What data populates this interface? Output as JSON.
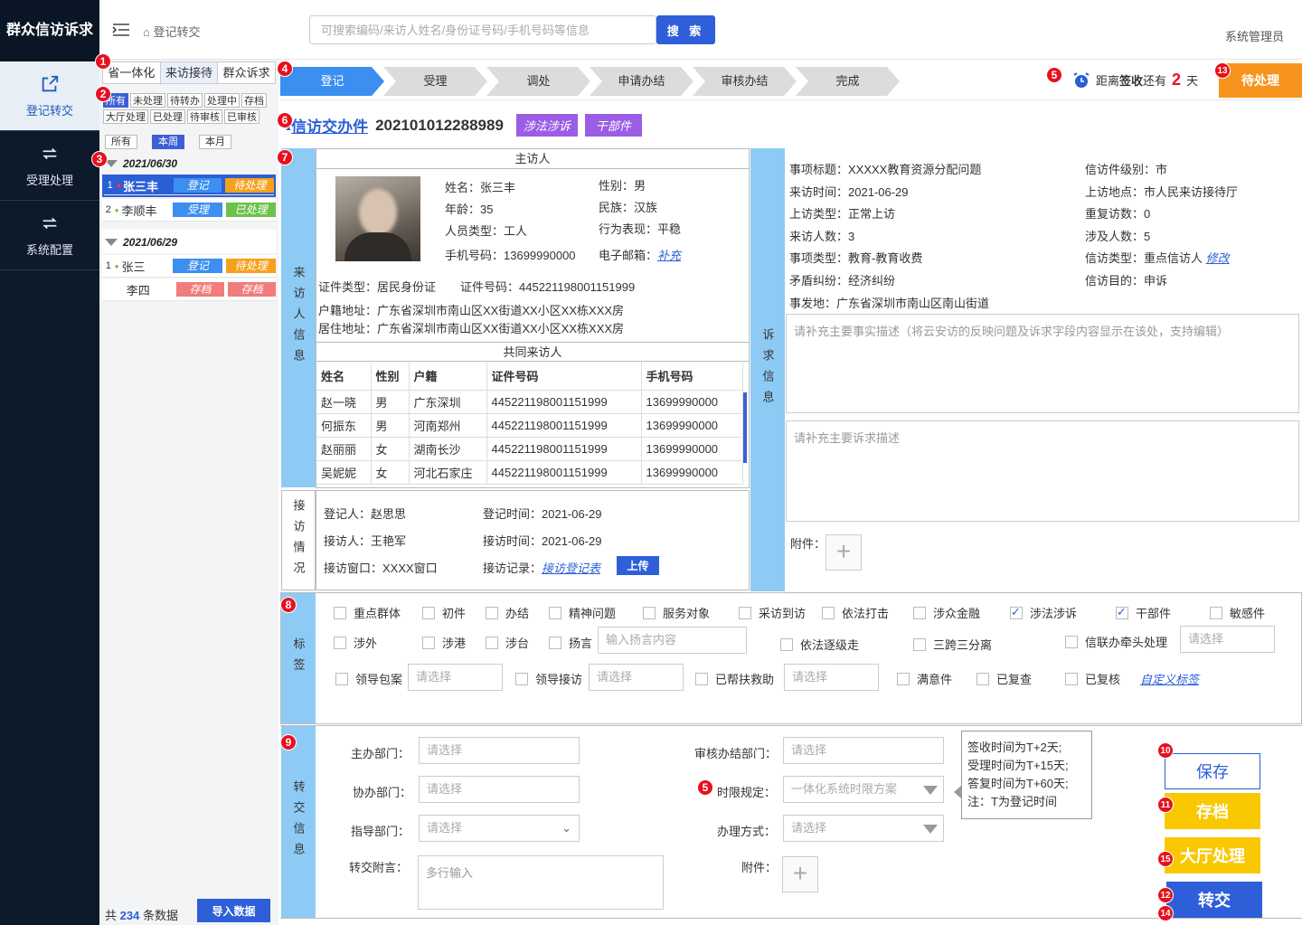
{
  "app": {
    "title": "群众信访诉求"
  },
  "nav": [
    {
      "label": "登记转交",
      "icon": "edit-share-icon",
      "active": true
    },
    {
      "label": "受理处理",
      "icon": "loop-arrows-icon"
    },
    {
      "label": "系统配置",
      "icon": "loop-arrows-icon"
    }
  ],
  "header": {
    "breadcrumb": "登记转交",
    "search_placeholder": "可搜索编码/来访人姓名/身份证号码/手机号码等信息",
    "search_button": "搜 索",
    "user": "系统管理员"
  },
  "left": {
    "tabs": [
      "省一体化",
      "来访接待",
      "群众诉求"
    ],
    "filters1": [
      "所有",
      "未处理",
      "待转办",
      "处理中",
      "存档"
    ],
    "filters2": [
      "大厅处理",
      "已处理",
      "待审核",
      "已审核"
    ],
    "periods": [
      "所有",
      "本周",
      "本月"
    ],
    "groups": [
      {
        "date": "2021/06/30",
        "rows": [
          {
            "no": "1",
            "name": "张三丰",
            "status": "登记",
            "state": "待处理"
          },
          {
            "no": "2",
            "name": "李顺丰",
            "status": "受理",
            "state": "已处理"
          }
        ]
      },
      {
        "date": "2021/06/29",
        "rows": [
          {
            "no": "1",
            "name": "张三",
            "status": "登记",
            "state": "待处理"
          },
          {
            "no": "",
            "name": "李四",
            "status": "存档",
            "state": "存档"
          }
        ]
      }
    ],
    "footer_pre": "共",
    "footer_count": "234",
    "footer_post": "条数据",
    "import_button": "导入数据"
  },
  "badges": [
    "1",
    "2",
    "3",
    "4",
    "5",
    "6",
    "7",
    "8",
    "9",
    "10",
    "11",
    "12",
    "13",
    "14",
    "15"
  ],
  "steps": [
    "登记",
    "受理",
    "调处",
    "申请办结",
    "审核办结",
    "完成"
  ],
  "deadline": {
    "pre": "距离",
    "bold": "签收",
    "mid": "还有",
    "num": "2",
    "post": "天",
    "status_button": "待处理"
  },
  "case": {
    "title": "信访交办件",
    "number": "202101012288989",
    "tags": [
      "涉法涉诉",
      "干部件"
    ]
  },
  "visitor": {
    "side_label": "来访人信息",
    "head": "主访人",
    "name": "姓名：张三丰",
    "gender": "性别：男",
    "age": "年龄：35",
    "ethnic": "民族：汉族",
    "ptype": "人员类型：工人",
    "behavior": "行为表现：平稳",
    "phone": "手机号码：13699990000",
    "email_label": "电子邮箱：",
    "email_link": "补充",
    "id_type": "证件类型：居民身份证",
    "id_no": "证件号码：445221198001151999",
    "hukou": "户籍地址：广东省深圳市南山区XX街道XX小区XX栋XXX房",
    "live": "居住地址：广东省深圳市南山区XX街道XX小区XX栋XXX房",
    "co_head": "共同来访人",
    "co_cols": [
      "姓名",
      "性别",
      "户籍",
      "证件号码",
      "手机号码"
    ],
    "co_rows": [
      [
        "赵一晓",
        "男",
        "广东深圳",
        "445221198001151999",
        "13699990000"
      ],
      [
        "何振东",
        "男",
        "河南郑州",
        "445221198001151999",
        "13699990000"
      ],
      [
        "赵丽丽",
        "女",
        "湖南长沙",
        "445221198001151999",
        "13699990000"
      ],
      [
        "吴妮妮",
        "女",
        "河北石家庄",
        "445221198001151999",
        "13699990000"
      ]
    ]
  },
  "reception": {
    "side_label": "接访情况",
    "reg_person": "登记人：赵思思",
    "reg_time": "登记时间：2021-06-29",
    "rec_person": "接访人：王艳军",
    "rec_time": "接访时间：2021-06-29",
    "window": "接访窗口：XXXX窗口",
    "record_label": "接访记录：",
    "record_link": "接访登记表",
    "upload": "上传"
  },
  "appeal": {
    "side_label": "诉求信息",
    "subject": "事项标题：XXXXX教育资源分配问题",
    "level": "信访件级别：市",
    "time": "来访时间：2021-06-29",
    "place": "上访地点：市人民来访接待厅",
    "vtype": "上访类型：正常上访",
    "repeat": "重复访数：0",
    "count": "来访人数：3",
    "involved": "涉及人数：5",
    "itype": "事项类型：教育-教育收费",
    "ptype_label": "信访类型：重点信访人",
    "modify": "修改",
    "conflict": "矛盾纠纷：经济纠纷",
    "purpose": "信访目的：申诉",
    "location": "事发地：广东省深圳市南山区南山街道",
    "fact_ph": "请补充主要事实描述（将云安访的反映问题及诉求字段内容显示在该处，支持编辑）",
    "req_ph": "请补充主要诉求描述",
    "attach": "附件："
  },
  "tags_section": {
    "side_label": "标签",
    "row1": [
      {
        "label": "重点群体",
        "on": false
      },
      {
        "label": "初件",
        "on": false
      },
      {
        "label": "办结",
        "on": false
      },
      {
        "label": "精神问题",
        "on": false
      },
      {
        "label": "服务对象",
        "on": false
      },
      {
        "label": "采访到访",
        "on": false
      },
      {
        "label": "依法打击",
        "on": false
      },
      {
        "label": "涉众金融",
        "on": false
      },
      {
        "label": "涉法涉诉",
        "on": true
      },
      {
        "label": "干部件",
        "on": true
      },
      {
        "label": "敏感件",
        "on": false
      }
    ],
    "row2": [
      {
        "label": "涉外"
      },
      {
        "label": "涉港"
      },
      {
        "label": "涉台"
      },
      {
        "label": "扬言"
      },
      {
        "label": "依法逐级走"
      },
      {
        "label": "三跨三分离"
      },
      {
        "label": "信联办牵头处理"
      }
    ],
    "yangyan_ph": "输入扬言内容",
    "select_ph": "请选择",
    "row3": [
      {
        "label": "领导包案"
      },
      {
        "label": "领导接访"
      },
      {
        "label": "已帮扶救助"
      },
      {
        "label": "满意件"
      },
      {
        "label": "已复查"
      },
      {
        "label": "已复核"
      }
    ],
    "custom": "自定义标签"
  },
  "transfer": {
    "side_label": "转交信息",
    "main_dept": "主办部门：",
    "assist_dept": "协办部门：",
    "guide_dept": "指导部门：",
    "note": "转交附言：",
    "review_dept": "审核办结部门：",
    "limit": "时限规定：",
    "method": "办理方式：",
    "attach": "附件：",
    "select_ph": "请选择",
    "limit_val": "一体化系统时限方案",
    "note_ph": "多行输入",
    "tips": [
      "签收时间为T+2天;",
      "受理时间为T+15天;",
      "答复时间为T+60天;",
      "注：T为登记时间"
    ],
    "save": "保存",
    "archive": "存档",
    "hall": "大厅处理",
    "transfer": "转交"
  },
  "colors": {
    "nav": "#0d1a2c",
    "accent": "#2f5fd8",
    "orange": "#f7941d",
    "yellow": "#f9c800",
    "purple": "#9b5de5",
    "side": "#8ecbf4"
  }
}
